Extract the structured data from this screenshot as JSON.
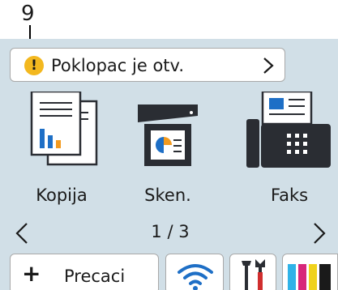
{
  "callout": {
    "number": "9"
  },
  "notice": {
    "text": "Poklopac je otv.",
    "icon": "warning-icon"
  },
  "tiles": [
    {
      "label": "Kopija",
      "icon": "copy-icon"
    },
    {
      "label": "Sken.",
      "icon": "scan-icon"
    },
    {
      "label": "Faks",
      "icon": "fax-icon"
    }
  ],
  "pager": {
    "page": "1 / 3"
  },
  "bottom": {
    "shortcuts_label": "Precaci",
    "shortcuts_icon": "plus-icon",
    "wifi_icon": "wifi-icon",
    "tools_icon": "tools-icon",
    "ink_icon": "ink-icon"
  },
  "colors": {
    "panel": "#d1dfe7",
    "accent_blue": "#1e6fc6",
    "warning": "#f3b81f",
    "dark": "#2a2d33"
  }
}
